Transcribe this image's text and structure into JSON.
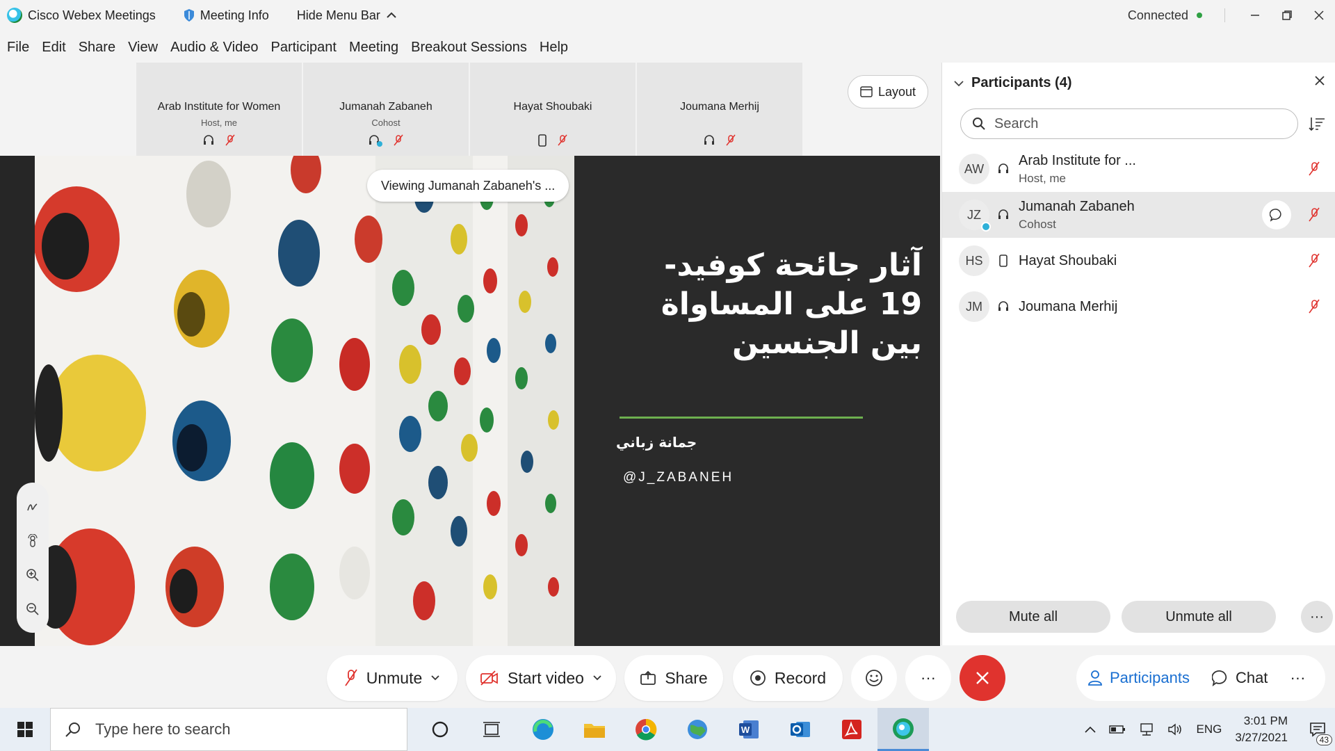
{
  "titlebar": {
    "app_name": "Cisco Webex Meetings",
    "meeting_info": "Meeting Info",
    "hide_menu": "Hide Menu Bar",
    "status": "Connected"
  },
  "menu": [
    "File",
    "Edit",
    "Share",
    "View",
    "Audio & Video",
    "Participant",
    "Meeting",
    "Breakout Sessions",
    "Help"
  ],
  "tiles": [
    {
      "name": "Arab Institute for Women",
      "role": "Host, me"
    },
    {
      "name": "Jumanah Zabaneh",
      "role": "Cohost"
    },
    {
      "name": "Hayat Shoubaki",
      "role": ""
    },
    {
      "name": "Joumana Merhij",
      "role": ""
    }
  ],
  "layout_label": "Layout",
  "viewing_label": "Viewing Jumanah Zabaneh's ...",
  "slide": {
    "title": "آثار جائحة كوفيد- 19 على المساواة بين الجنسين",
    "author": "جمانة زباني",
    "handle": "@J_ZABANEH"
  },
  "panel": {
    "title": "Participants (4)",
    "search_placeholder": "Search",
    "participants": [
      {
        "initials": "AW",
        "name": "Arab Institute for ...",
        "role": "Host, me",
        "device": "headset-icon"
      },
      {
        "initials": "JZ",
        "name": "Jumanah Zabaneh",
        "role": "Cohost",
        "device": "headset-icon"
      },
      {
        "initials": "HS",
        "name": "Hayat Shoubaki",
        "role": "",
        "device": "phone-icon"
      },
      {
        "initials": "JM",
        "name": "Joumana Merhij",
        "role": "",
        "device": "headset-icon"
      }
    ],
    "mute_all": "Mute all",
    "unmute_all": "Unmute all"
  },
  "controls": {
    "unmute": "Unmute",
    "start_video": "Start video",
    "share": "Share",
    "record": "Record",
    "participants": "Participants",
    "chat": "Chat"
  },
  "taskbar": {
    "search_placeholder": "Type here to search",
    "lang": "ENG",
    "time": "3:01 PM",
    "date": "3/27/2021",
    "notifications": "43"
  },
  "colors": {
    "accent": "#1a6fd1",
    "end_call": "#e0332e",
    "muted": "#e0332e",
    "connected": "#2ea043",
    "divider_line": "#6db04f"
  }
}
